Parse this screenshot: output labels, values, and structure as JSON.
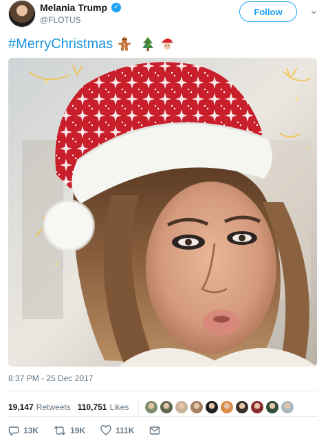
{
  "tweet": {
    "author": {
      "display_name": "Melania Trump",
      "handle": "@FLOTUS",
      "verified_icon": "verified-badge-icon"
    },
    "follow_label": "Follow",
    "text": {
      "hashtag": "#MerryChristmas",
      "emojis": [
        "gingerbread-man-icon",
        "christmas-tree-icon",
        "santa-icon"
      ]
    },
    "media": {
      "description_icon": "photo"
    },
    "timestamp": "8:37 PM - 25 Dec 2017",
    "stats": {
      "retweets_count": "19,147",
      "retweets_label": "Retweets",
      "likes_count": "110,751",
      "likes_label": "Likes"
    },
    "liker_avatar_colors": [
      "#7c8e6e",
      "#5e6a4f",
      "#c9b39a",
      "#a67c63",
      "#1e1e1e",
      "#d98c45",
      "#3a2e2a",
      "#8a2b2b",
      "#2e4d3a",
      "#aab8c2"
    ],
    "actions": {
      "reply_count": "13K",
      "retweet_count": "19K",
      "like_count": "111K"
    },
    "colors": {
      "accent": "#1da1f2",
      "hashtag": "#1b95e0",
      "muted": "#657786"
    }
  }
}
